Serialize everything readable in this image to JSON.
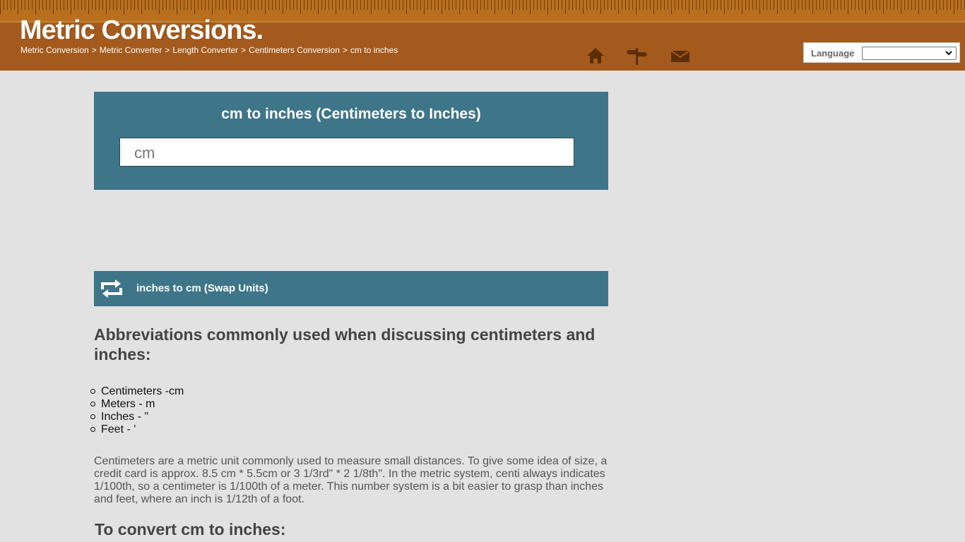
{
  "header": {
    "logo": "Metric Conversions.",
    "breadcrumb": [
      "Metric Conversion",
      "Metric Converter",
      "Length Converter",
      "Centimeters Conversion",
      "cm to inches"
    ],
    "breadcrumb_separator": ">",
    "nav_icons": [
      "home-icon",
      "signpost-icon",
      "mail-icon"
    ],
    "language_label": "Language",
    "language_selected": ""
  },
  "converter": {
    "title": "cm to inches (Centimeters to Inches)",
    "input_placeholder": "cm"
  },
  "swap": {
    "label": "inches to cm (Swap Units)",
    "icon": "swap-arrows-icon"
  },
  "content": {
    "abbr_heading": "Abbreviations commonly used when discussing centimeters and inches:",
    "abbr_items": [
      "Centimeters -cm",
      "Meters - m",
      "Inches - \"",
      "Feet - '"
    ],
    "paragraph": "Centimeters are a metric unit commonly used to measure small distances. To give some idea of size, a credit card is approx. 8.5 cm * 5.5cm or 3 1/3rd\" * 2 1/8th\". In the metric system, centi always indicates 1/100th, so a centimeter is 1/100th of a meter. This number system is a bit easier to grasp than inches and feet, where an inch is 1/12th of a foot.",
    "convert_heading": "To convert cm to inches:"
  },
  "colors": {
    "header": "#a35a1c",
    "panel": "#3e7589",
    "background": "#e2e2e2"
  }
}
